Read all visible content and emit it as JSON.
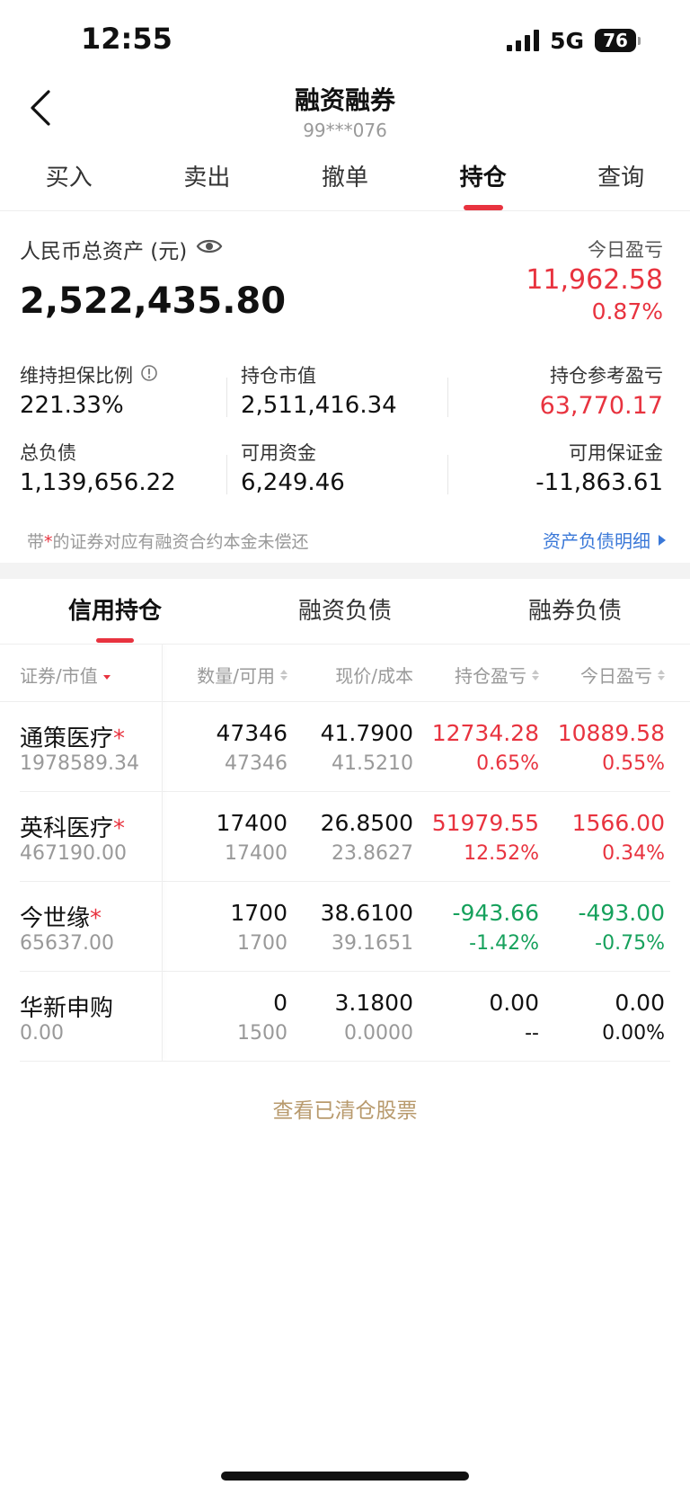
{
  "status_bar": {
    "time": "12:55",
    "network": "5G",
    "battery": "76"
  },
  "header": {
    "title": "融资融券",
    "account": "99***076"
  },
  "tabs": [
    "买入",
    "卖出",
    "撤单",
    "持仓",
    "查询"
  ],
  "active_tab": "持仓",
  "assets": {
    "total_label": "人民币总资产 (元)",
    "total_value": "2,522,435.80",
    "today_pnl_label": "今日盈亏",
    "today_pnl_value": "11,962.58",
    "today_pnl_pct": "0.87%",
    "maintain_ratio_label": "维持担保比例",
    "maintain_ratio_value": "221.33%",
    "position_mv_label": "持仓市值",
    "position_mv_value": "2,511,416.34",
    "ref_pnl_label": "持仓参考盈亏",
    "ref_pnl_value": "63,770.17",
    "total_debt_label": "总负债",
    "total_debt_value": "1,139,656.22",
    "available_cash_label": "可用资金",
    "available_cash_value": "6,249.46",
    "available_margin_label": "可用保证金",
    "available_margin_value": "-11,863.61",
    "note_prefix": "带",
    "note_star": "*",
    "note_suffix": "的证券对应有融资合约本金未偿还",
    "detail_link": "资产负债明细"
  },
  "sub_tabs": [
    "信用持仓",
    "融资负债",
    "融券负债"
  ],
  "table": {
    "headers": [
      "证券/市值",
      "数量/可用",
      "现价/成本",
      "持仓盈亏",
      "今日盈亏"
    ],
    "rows": [
      {
        "name": "通策医疗",
        "star": "*",
        "market_value": "1978589.34",
        "qty": "47346",
        "available": "47346",
        "price": "41.7900",
        "cost": "41.5210",
        "pos_pnl": "12734.28",
        "pos_pnl_pct": "0.65%",
        "today_pnl": "10889.58",
        "today_pnl_pct": "0.55%",
        "pos_color": "red",
        "today_color": "red"
      },
      {
        "name": "英科医疗",
        "star": "*",
        "market_value": "467190.00",
        "qty": "17400",
        "available": "17400",
        "price": "26.8500",
        "cost": "23.8627",
        "pos_pnl": "51979.55",
        "pos_pnl_pct": "12.52%",
        "today_pnl": "1566.00",
        "today_pnl_pct": "0.34%",
        "pos_color": "red",
        "today_color": "red"
      },
      {
        "name": "今世缘",
        "star": "*",
        "market_value": "65637.00",
        "qty": "1700",
        "available": "1700",
        "price": "38.6100",
        "cost": "39.1651",
        "pos_pnl": "-943.66",
        "pos_pnl_pct": "-1.42%",
        "today_pnl": "-493.00",
        "today_pnl_pct": "-0.75%",
        "pos_color": "green",
        "today_color": "green"
      },
      {
        "name": "华新申购",
        "star": "",
        "market_value": "0.00",
        "qty": "0",
        "available": "1500",
        "price": "3.1800",
        "cost": "0.0000",
        "pos_pnl": "0.00",
        "pos_pnl_pct": "--",
        "today_pnl": "0.00",
        "today_pnl_pct": "0.00%",
        "pos_color": "black",
        "today_color": "black"
      }
    ]
  },
  "cleared_link": "查看已清仓股票",
  "colors": {
    "up": "#e8333f",
    "down": "#16a15c",
    "link": "#3a78d8",
    "gold": "#b89a6d"
  }
}
